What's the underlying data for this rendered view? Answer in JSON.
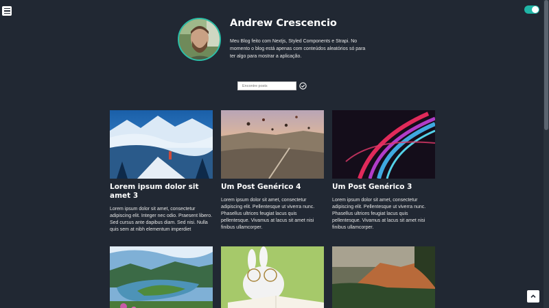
{
  "header": {
    "menu_icon": "hamburger-menu-icon",
    "theme_toggle_state": "on"
  },
  "profile": {
    "name": "Andrew Crescencio",
    "description": "Meu Blog feito com Nextjs, Styled Components e Strapi. No momento o blog está apenas com conteúdos aleatórios só para ter algo para mostrar a aplicação."
  },
  "search": {
    "placeholder": "Encontre posts",
    "submit_icon": "check-circle-icon"
  },
  "posts": [
    {
      "title": "Lorem ipsum dolor sit amet 3",
      "excerpt": "Lorem ipsum dolor sit amet, consectetur adipiscing elit. Integer nec odio. Praesent libero. Sed cursus ante dapibus diam. Sed nisi. Nulla quis sem at nibh elementum imperdiet"
    },
    {
      "title": "Um Post Genérico 4",
      "excerpt": "Lorem ipsum dolor sit amet, consectetur adipiscing elit. Pellentesque ut viverra nunc. Phasellus ultrices feugiat lacus quis pellentesque. Vivamus at lacus sit amet nisi finibus ullamcorper."
    },
    {
      "title": "Um Post Genérico 3",
      "excerpt": "Lorem ipsum dolor sit amet, consectetur adipiscing elit. Pellentesque ut viverra nunc. Phasellus ultrices feugiat lacus quis pellentesque. Vivamus at lacus sit amet nisi finibus ullamcorper."
    }
  ],
  "scroll_to_top_icon": "chevron-up-icon",
  "colors": {
    "background": "#212833",
    "accent": "#1fb5a6"
  }
}
